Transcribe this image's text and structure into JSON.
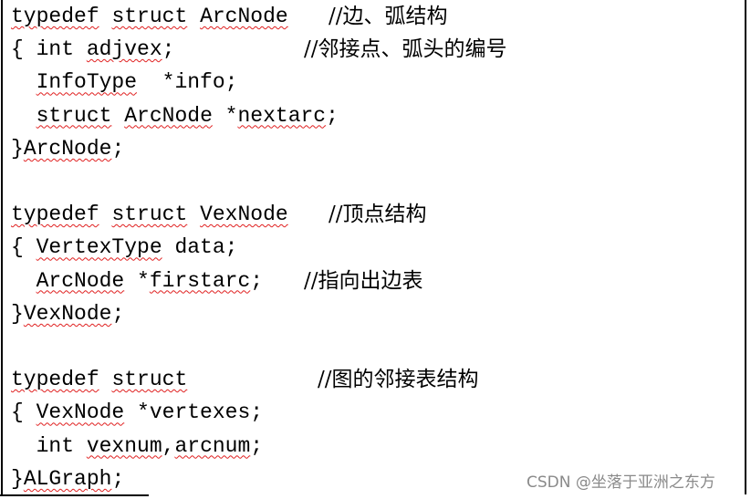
{
  "document": {
    "lines": [
      {
        "tokens": [
          {
            "t": "typedef",
            "u": true
          },
          {
            "t": " "
          },
          {
            "t": "struct",
            "u": true
          },
          {
            "t": " "
          },
          {
            "t": "ArcNode",
            "u": true
          }
        ],
        "comment": "//边、弧结构"
      },
      {
        "tokens": [
          {
            "t": "{ int "
          },
          {
            "t": "adjvex",
            "u": true
          },
          {
            "t": ";"
          }
        ],
        "comment": "//邻接点、弧头的编号"
      },
      {
        "tokens": [
          {
            "t": "  "
          },
          {
            "t": "InfoType",
            "u": true
          },
          {
            "t": "  *info;"
          }
        ],
        "comment": ""
      },
      {
        "tokens": [
          {
            "t": "  "
          },
          {
            "t": "struct",
            "u": true
          },
          {
            "t": " "
          },
          {
            "t": "ArcNode",
            "u": true
          },
          {
            "t": " *"
          },
          {
            "t": "nextarc",
            "u": true
          },
          {
            "t": ";"
          }
        ],
        "comment": ""
      },
      {
        "tokens": [
          {
            "t": "}"
          },
          {
            "t": "ArcNode",
            "u": true
          },
          {
            "t": ";"
          }
        ],
        "comment": ""
      },
      {
        "tokens": [],
        "comment": ""
      },
      {
        "tokens": [
          {
            "t": "typedef",
            "u": true
          },
          {
            "t": " "
          },
          {
            "t": "struct",
            "u": true
          },
          {
            "t": " "
          },
          {
            "t": "VexNode",
            "u": true
          }
        ],
        "comment": "//顶点结构"
      },
      {
        "tokens": [
          {
            "t": "{ "
          },
          {
            "t": "VertexType",
            "u": true
          },
          {
            "t": " data;"
          }
        ],
        "comment": ""
      },
      {
        "tokens": [
          {
            "t": "  "
          },
          {
            "t": "ArcNode",
            "u": true
          },
          {
            "t": " *"
          },
          {
            "t": "firstarc",
            "u": true
          },
          {
            "t": ";"
          }
        ],
        "comment": "//指向出边表"
      },
      {
        "tokens": [
          {
            "t": "}"
          },
          {
            "t": "VexNode",
            "u": true
          },
          {
            "t": ";"
          }
        ],
        "comment": ""
      },
      {
        "tokens": [],
        "comment": ""
      },
      {
        "tokens": [
          {
            "t": "typedef",
            "u": true
          },
          {
            "t": " "
          },
          {
            "t": "struct",
            "u": true
          }
        ],
        "comment": "//图的邻接表结构"
      },
      {
        "tokens": [
          {
            "t": "{ "
          },
          {
            "t": "VexNode",
            "u": true
          },
          {
            "t": " *vertexes;"
          }
        ],
        "comment": ""
      },
      {
        "tokens": [
          {
            "t": "  int "
          },
          {
            "t": "vexnum",
            "u": true
          },
          {
            "t": ","
          },
          {
            "t": "arcnum",
            "u": true
          },
          {
            "t": ";"
          }
        ],
        "comment": ""
      },
      {
        "tokens": [
          {
            "t": "}"
          },
          {
            "t": "ALGraph",
            "u": true
          },
          {
            "t": ";"
          }
        ],
        "comment": ""
      }
    ]
  },
  "watermark": "CSDN @坐落于亚洲之东方",
  "colors": {
    "spellcheck_underline": "#e02020",
    "watermark": "#8a8a8a"
  }
}
